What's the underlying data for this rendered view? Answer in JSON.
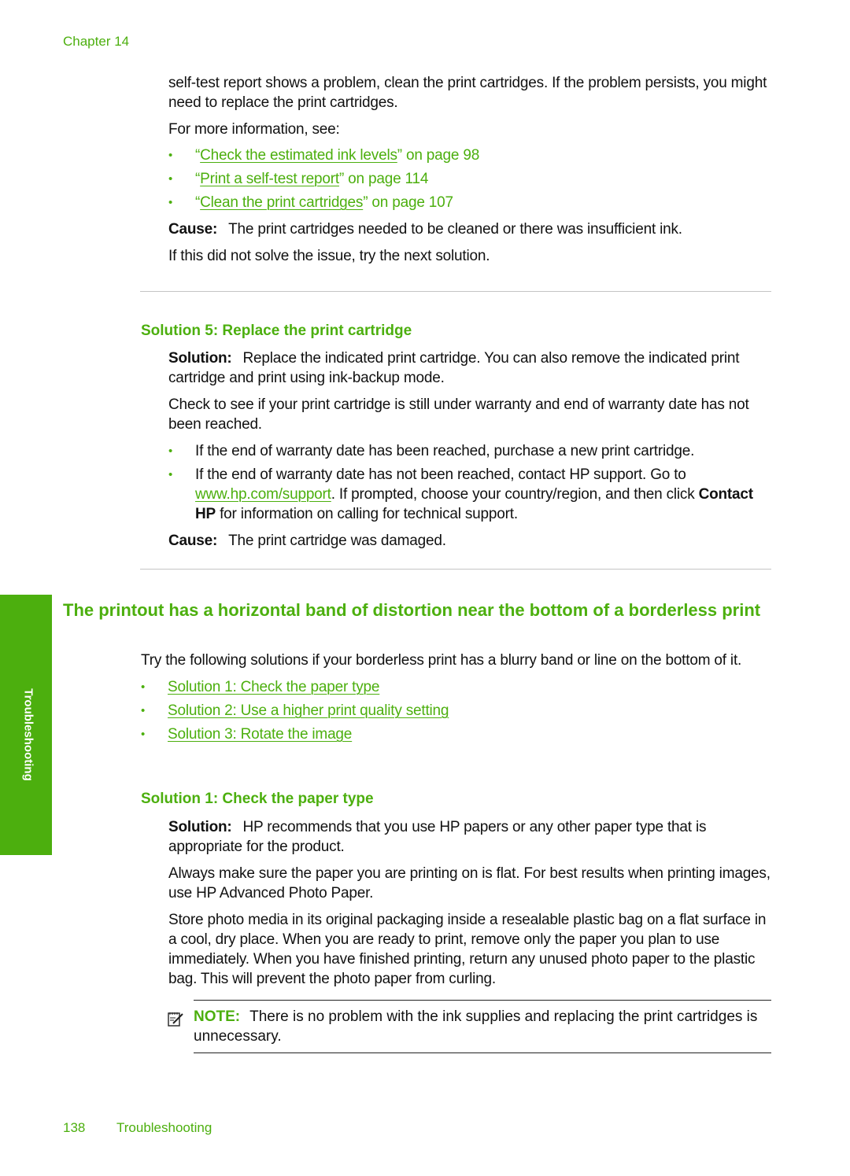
{
  "header": {
    "chapter": "Chapter 14"
  },
  "section_top": {
    "intro_line1": "self-test report shows a problem, clean the print cartridges. If the problem persists, you might need to replace the print cartridges.",
    "more_info": "For more information, see:",
    "refs": [
      {
        "link": "Check the estimated ink levels",
        "suffix": "” on page 98"
      },
      {
        "link": "Print a self-test report",
        "suffix": "” on page 114"
      },
      {
        "link": "Clean the print cartridges",
        "suffix": "” on page 107"
      }
    ],
    "cause_label": "Cause:",
    "cause_text": "The print cartridges needed to be cleaned or there was insufficient ink.",
    "next": "If this did not solve the issue, try the next solution."
  },
  "solution5": {
    "heading": "Solution 5: Replace the print cartridge",
    "solution_label": "Solution:",
    "solution_text": "Replace the indicated print cartridge. You can also remove the indicated print cartridge and print using ink-backup mode.",
    "check_text": "Check to see if your print cartridge is still under warranty and end of warranty date has not been reached.",
    "bullet1": "If the end of warranty date has been reached, purchase a new print cartridge.",
    "bullet2_pre": "If the end of warranty date has not been reached, contact HP support. Go to ",
    "bullet2_link": "www.hp.com/support",
    "bullet2_mid": ". If prompted, choose your country/region, and then click ",
    "bullet2_bold": "Contact HP",
    "bullet2_post": " for information on calling for technical support.",
    "cause_label": "Cause:",
    "cause_text": "The print cartridge was damaged."
  },
  "section_main": {
    "heading": "The printout has a horizontal band of distortion near the bottom of a borderless print",
    "intro": "Try the following solutions if your borderless print has a blurry band or line on the bottom of it.",
    "links": [
      "Solution 1: Check the paper type",
      "Solution 2: Use a higher print quality setting",
      "Solution 3: Rotate the image"
    ]
  },
  "solution1": {
    "heading": "Solution 1: Check the paper type",
    "solution_label": "Solution:",
    "solution_text": "HP recommends that you use HP papers or any other paper type that is appropriate for the product.",
    "para2": "Always make sure the paper you are printing on is flat. For best results when printing images, use HP Advanced Photo Paper.",
    "para3": "Store photo media in its original packaging inside a resealable plastic bag on a flat surface in a cool, dry place. When you are ready to print, remove only the paper you plan to use immediately. When you have finished printing, return any unused photo paper to the plastic bag. This will prevent the photo paper from curling.",
    "note_label": "NOTE:",
    "note_text": "There is no problem with the ink supplies and replacing the print cartridges is unnecessary."
  },
  "side_tab": {
    "label": "Troubleshooting"
  },
  "footer": {
    "page_number": "138",
    "section": "Troubleshooting"
  },
  "quote_open": "“",
  "bullet_char": "•"
}
